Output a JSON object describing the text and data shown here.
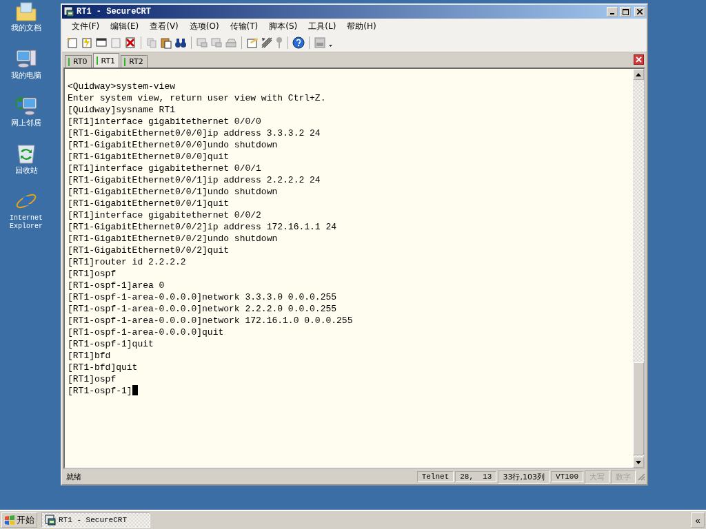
{
  "desktop_icons": [
    {
      "label": "我的文档",
      "kind": "folder"
    },
    {
      "label": "我的电脑",
      "kind": "computer"
    },
    {
      "label": "网上邻居",
      "kind": "network"
    },
    {
      "label": "回收站",
      "kind": "recycle"
    },
    {
      "label": "Internet Explorer",
      "kind": "browser"
    }
  ],
  "window": {
    "title": "RT1 - SecureCRT"
  },
  "menu": [
    "文件(F)",
    "编辑(E)",
    "查看(V)",
    "选项(O)",
    "传输(T)",
    "脚本(S)",
    "工具(L)",
    "帮助(H)"
  ],
  "tabs": [
    {
      "label": "RT0",
      "selected": false
    },
    {
      "label": "RT1",
      "selected": true
    },
    {
      "label": "RT2",
      "selected": false
    }
  ],
  "terminal": {
    "lines": [
      "<Quidway>system-view",
      "Enter system view, return user view with Ctrl+Z.",
      "[Quidway]sysname RT1",
      "[RT1]interface gigabitethernet 0/0/0",
      "[RT1-GigabitEthernet0/0/0]ip address 3.3.3.2 24",
      "[RT1-GigabitEthernet0/0/0]undo shutdown",
      "[RT1-GigabitEthernet0/0/0]quit",
      "[RT1]interface gigabitethernet 0/0/1",
      "[RT1-GigabitEthernet0/0/1]ip address 2.2.2.2 24",
      "[RT1-GigabitEthernet0/0/1]undo shutdown",
      "[RT1-GigabitEthernet0/0/1]quit",
      "[RT1]interface gigabitethernet 0/0/2",
      "[RT1-GigabitEthernet0/0/2]ip address 172.16.1.1 24",
      "[RT1-GigabitEthernet0/0/2]undo shutdown",
      "[RT1-GigabitEthernet0/0/2]quit",
      "[RT1]router id 2.2.2.2",
      "[RT1]ospf",
      "[RT1-ospf-1]area 0",
      "[RT1-ospf-1-area-0.0.0.0]network 3.3.3.0 0.0.0.255",
      "[RT1-ospf-1-area-0.0.0.0]network 2.2.2.0 0.0.0.255",
      "[RT1-ospf-1-area-0.0.0.0]network 172.16.1.0 0.0.0.255",
      "[RT1-ospf-1-area-0.0.0.0]quit",
      "[RT1-ospf-1]quit",
      "[RT1]bfd",
      "[RT1-bfd]quit",
      "[RT1]ospf",
      "[RT1-ospf-1]"
    ]
  },
  "status_bar": {
    "message": "就绪",
    "panes": [
      {
        "text": "Telnet",
        "disabled": false
      },
      {
        "text": "28,  13",
        "disabled": false
      },
      {
        "text": "33行,103列",
        "disabled": false
      },
      {
        "text": "VT100",
        "disabled": false
      },
      {
        "text": "大写",
        "disabled": true
      },
      {
        "text": "数字",
        "disabled": true
      }
    ]
  },
  "taskbar": {
    "start": "开始",
    "tasks": [
      {
        "label": "RT1 - SecureCRT",
        "selected": true
      }
    ],
    "chevron": "«"
  }
}
